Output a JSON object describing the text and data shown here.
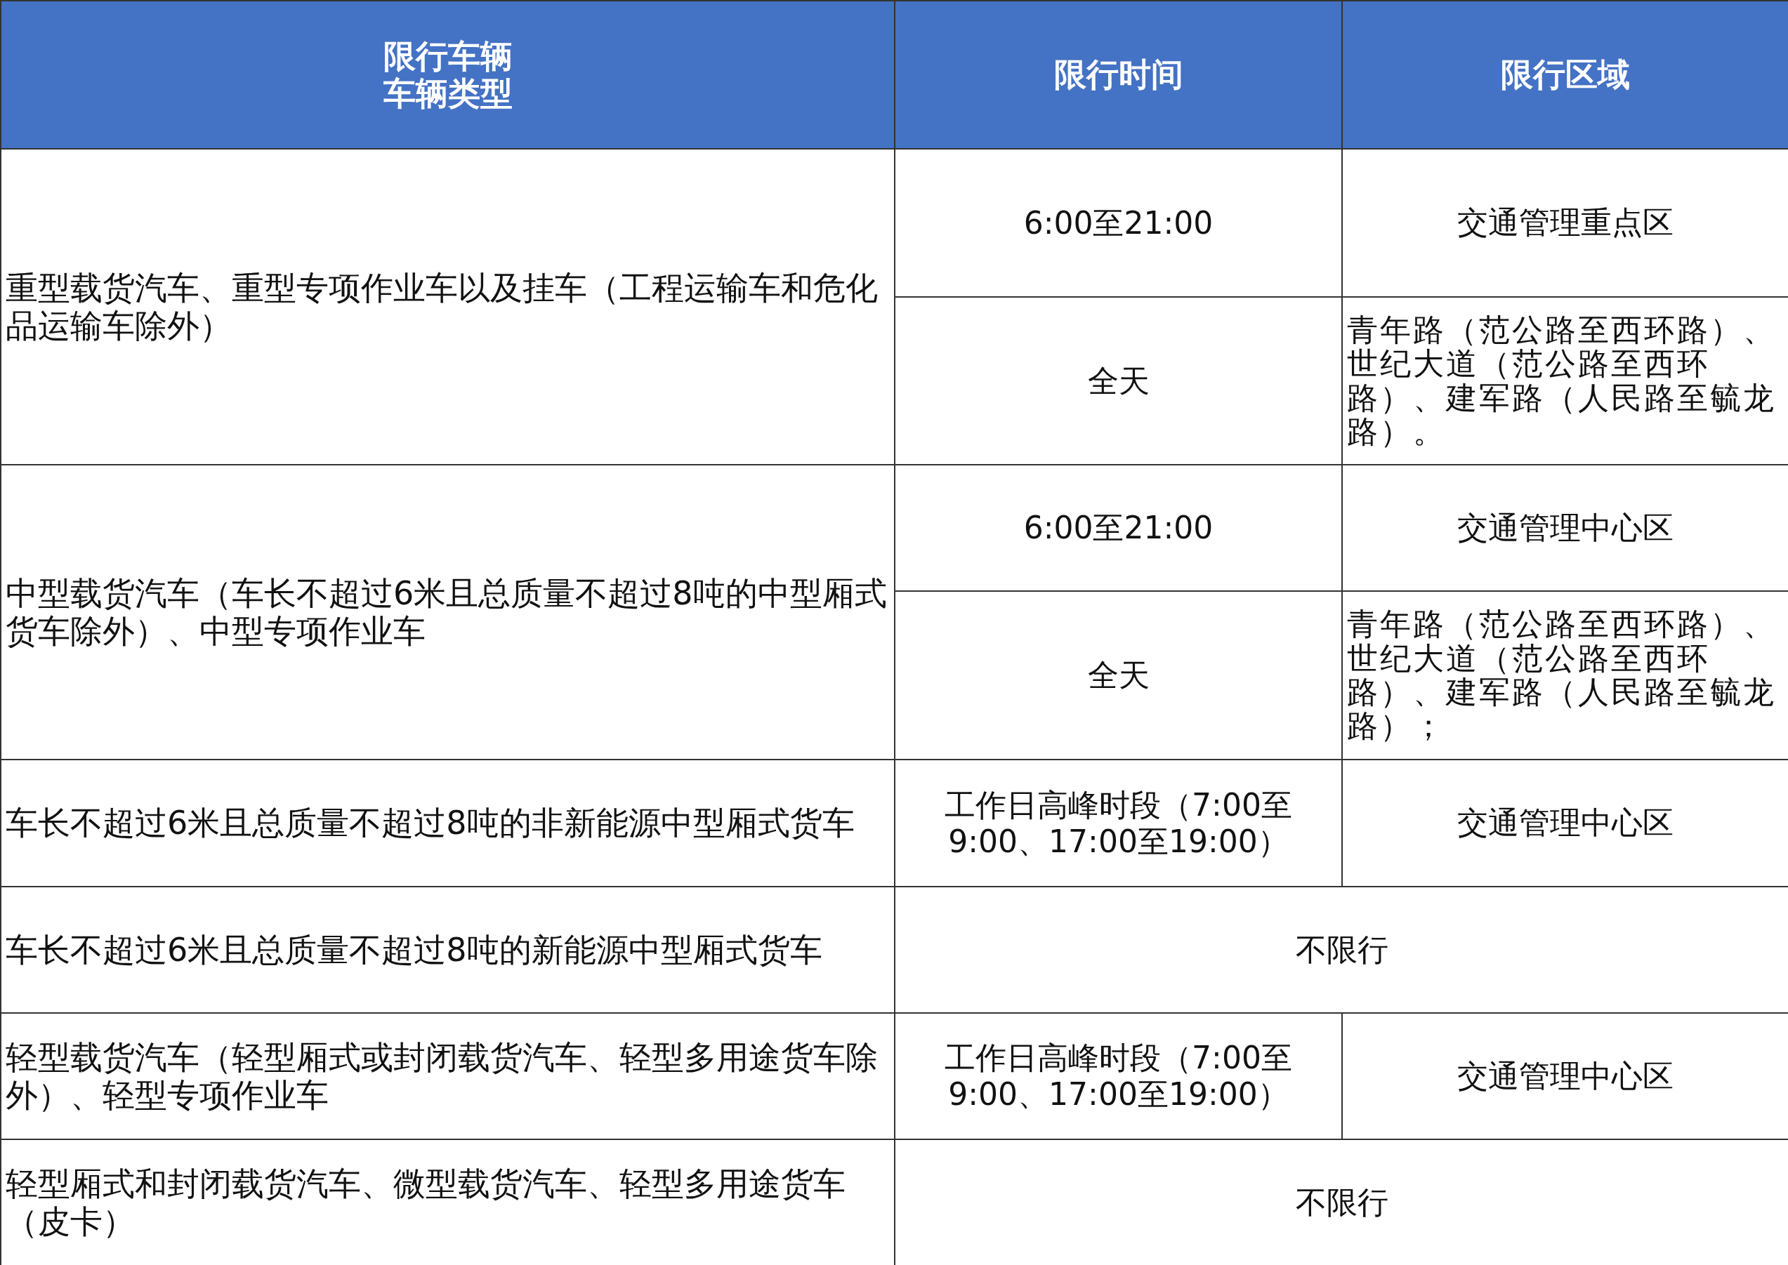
{
  "table": {
    "columns": [
      "限行车辆车辆类型",
      "限行时间",
      "限行区域"
    ],
    "rows": [
      {
        "kind": "split",
        "vehicle": "重型载货汽车、重型专项作业车以及挂车（工程运输车和危化品运输车除外）",
        "entries": [
          {
            "time": "6:00至21:00",
            "area": "交通管理重点区"
          },
          {
            "time": "全天",
            "area": "青年路（范公路至西环路）、世纪大道（范公路至西环路）、建军路（人民路至毓龙路）。"
          }
        ]
      },
      {
        "kind": "split",
        "vehicle": "中型载货汽车（车长不超过6米且总质量不超过8吨的中型厢式货车除外）、中型专项作业车",
        "entries": [
          {
            "time": "6:00至21:00",
            "area": "交通管理中心区"
          },
          {
            "time": "全天",
            "area": "青年路（范公路至西环路）、世纪大道（范公路至西环路）、建军路（人民路至毓龙路）；"
          }
        ]
      },
      {
        "kind": "split",
        "vehicle": "车长不超过6米且总质量不超过8吨的非新能源中型厢式货车",
        "entries": [
          {
            "time": "工作日高峰时段（7:00至9:00、17:00至19:00）",
            "area": "交通管理中心区"
          }
        ]
      },
      {
        "kind": "merged",
        "vehicle": "车长不超过6米且总质量不超过8吨的新能源中型厢式货车",
        "note": "不限行"
      },
      {
        "kind": "split",
        "vehicle": "轻型载货汽车（轻型厢式或封闭载货汽车、轻型多用途货车除外）、轻型专项作业车",
        "entries": [
          {
            "time": "工作日高峰时段（7:00至9:00、17:00至19:00）",
            "area": "交通管理中心区"
          }
        ]
      },
      {
        "kind": "merged",
        "vehicle": "轻型厢式和封闭载货汽车、微型载货汽车、轻型多用途货车（皮卡）",
        "note": "不限行"
      }
    ]
  }
}
